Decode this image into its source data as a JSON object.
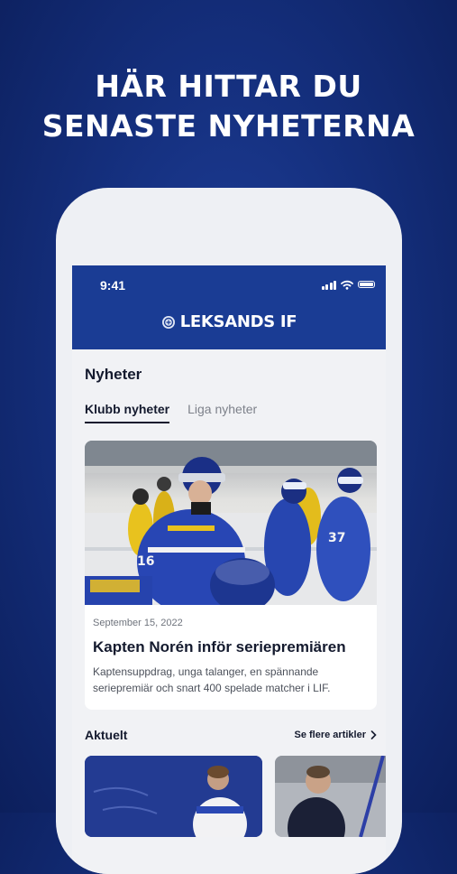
{
  "headline": {
    "line1": "HÄR HITTAR DU",
    "line2": "SENASTE NYHETERNA"
  },
  "status_bar": {
    "time": "9:41"
  },
  "app_header": {
    "brand": "LEKSANDS IF"
  },
  "news": {
    "title": "Nyheter",
    "tabs": [
      {
        "label": "Klubb nyheter",
        "active": true
      },
      {
        "label": "Liga nyheter",
        "active": false
      }
    ]
  },
  "featured_article": {
    "date": "September 15, 2022",
    "title": "Kapten Norén inför seriepremiären",
    "description": "Kaptensuppdrag, unga talanger, en spännande seriepremiär och snart 400 spelade matcher i LIF."
  },
  "current": {
    "title": "Aktuelt",
    "see_more": "Se flere artikler"
  },
  "colors": {
    "background": "#15307f",
    "header": "#1a3c94",
    "text": "#141a2e"
  }
}
